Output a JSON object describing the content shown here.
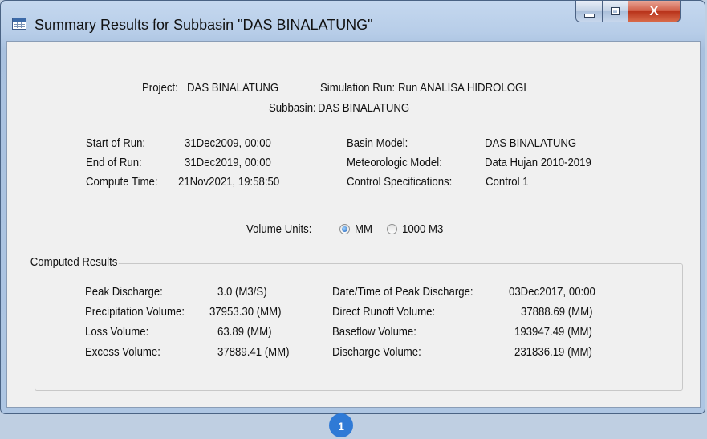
{
  "window": {
    "title": "Summary Results for Subbasin \"DAS BINALATUNG\"",
    "controls": {
      "minimize": "minimize",
      "maximize": "maximize",
      "close": "X"
    }
  },
  "header": {
    "project_label": "Project:",
    "project_value": "DAS BINALATUNG",
    "simrun_label": "Simulation Run:",
    "simrun_value": "Run ANALISA HIDROLOGI",
    "subbasin_label": "Subbasin:",
    "subbasin_value": "DAS BINALATUNG"
  },
  "run_info": {
    "left": [
      {
        "label": "Start of Run:",
        "value": "31Dec2009, 00:00"
      },
      {
        "label": "End of Run:",
        "value": "31Dec2019, 00:00"
      },
      {
        "label": "Compute Time:",
        "value": "21Nov2021, 19:58:50"
      }
    ],
    "right": [
      {
        "label": "Basin Model:",
        "value": "DAS BINALATUNG"
      },
      {
        "label": "Meteorologic Model:",
        "value": "Data Hujan 2010-2019"
      },
      {
        "label": "Control Specifications:",
        "value": "Control 1"
      }
    ]
  },
  "volume_units": {
    "label": "Volume Units:",
    "options": [
      {
        "label": "MM",
        "selected": true
      },
      {
        "label": "1000 M3",
        "selected": false
      }
    ]
  },
  "computed_results": {
    "title": "Computed Results",
    "left": [
      {
        "label": "Peak Discharge:",
        "value": "3.0 (M3/S)"
      },
      {
        "label": "Precipitation Volume:",
        "value": "37953.30 (MM)"
      },
      {
        "label": "Loss Volume:",
        "value": "63.89 (MM)"
      },
      {
        "label": "Excess Volume:",
        "value": "37889.41 (MM)"
      }
    ],
    "right": [
      {
        "label": "Date/Time of Peak Discharge:",
        "value": "03Dec2017, 00:00"
      },
      {
        "label": "Direct Runoff Volume:",
        "value": "37888.69 (MM)"
      },
      {
        "label": "Baseflow Volume:",
        "value": "193947.49 (MM)"
      },
      {
        "label": "Discharge Volume:",
        "value": "231836.19 (MM)"
      }
    ]
  },
  "badge": "1"
}
